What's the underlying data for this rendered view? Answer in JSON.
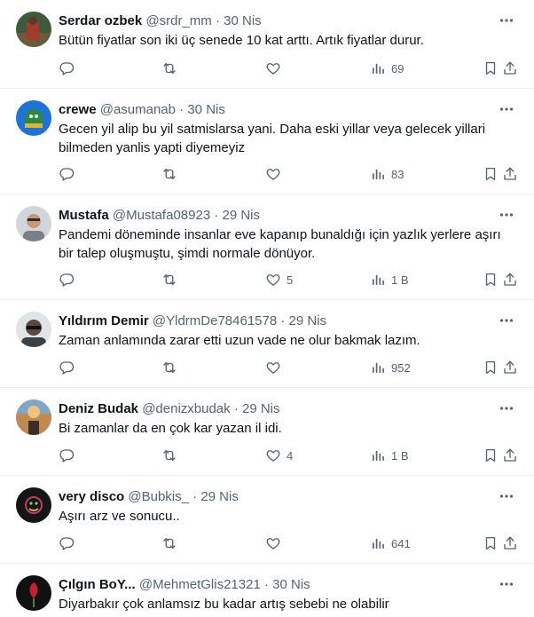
{
  "tweets": [
    {
      "name": "Serdar ozbek",
      "handle": "@srdr_mm",
      "sep": "·",
      "date": "30 Nis",
      "text": "Bütün fiyatlar son iki üç senede 10 kat arttı. Artık fiyatlar durur.",
      "replies": "",
      "retweets": "",
      "likes": "",
      "views": "69",
      "avatar_color": "#3f5a3a"
    },
    {
      "name": "crewe",
      "handle": "@asumanab",
      "sep": "·",
      "date": "30 Nis",
      "text": "Gecen yil alip bu yil satmislarsa yani. Daha eski yillar veya gelecek yillari bilmeden yanlis yapti diyemeyiz",
      "replies": "",
      "retweets": "",
      "likes": "",
      "views": "83",
      "avatar_color": "#1d73d8"
    },
    {
      "name": "Mustafa",
      "handle": "@Mustafa08923",
      "sep": "·",
      "date": "29 Nis",
      "text": "Pandemi döneminde insanlar eve kapanıp bunaldığı için yazlık yerlere aşırı bir talep oluşmuştu, şimdi normale dönüyor.",
      "replies": "",
      "retweets": "",
      "likes": "5",
      "views": "1 B",
      "avatar_color": "#9aa3ab"
    },
    {
      "name": "Yıldırım Demir",
      "handle": "@YldrmDe78461578",
      "sep": "·",
      "date": "29 Nis",
      "text": "Zaman anlamında zarar etti uzun vade ne olur bakmak lazım.",
      "replies": "",
      "retweets": "",
      "likes": "",
      "views": "952",
      "avatar_color": "#5a6a70"
    },
    {
      "name": "Deniz Budak",
      "handle": "@denizxbudak",
      "sep": "·",
      "date": "29 Nis",
      "text": "Bi zamanlar da en çok kar yazan il idi.",
      "replies": "",
      "retweets": "",
      "likes": "4",
      "views": "1 B",
      "avatar_color": "#c08a52"
    },
    {
      "name": "very disco",
      "handle": "@Bubkis_",
      "sep": "·",
      "date": "29 Nis",
      "text": "Aşırı arz ve sonucu..",
      "replies": "",
      "retweets": "",
      "likes": "",
      "views": "641",
      "avatar_color": "#151515"
    },
    {
      "name": "Çılgın BoY...",
      "handle": "@MehmetGlis21321",
      "sep": "·",
      "date": "30 Nis",
      "text": "Diyarbakır çok anlamsız bu kadar artış sebebi ne olabilir",
      "replies": "",
      "retweets": "",
      "likes": "",
      "views": "",
      "avatar_color": "#111111"
    }
  ],
  "icons": {
    "reply": "reply-icon",
    "retweet": "retweet-icon",
    "like": "like-icon",
    "views": "views-icon",
    "bookmark": "bookmark-icon",
    "share": "share-icon",
    "more": "more-icon"
  },
  "colors": {
    "text": "#0f1419",
    "secondary": "#536471",
    "divider": "#eff3f4"
  }
}
